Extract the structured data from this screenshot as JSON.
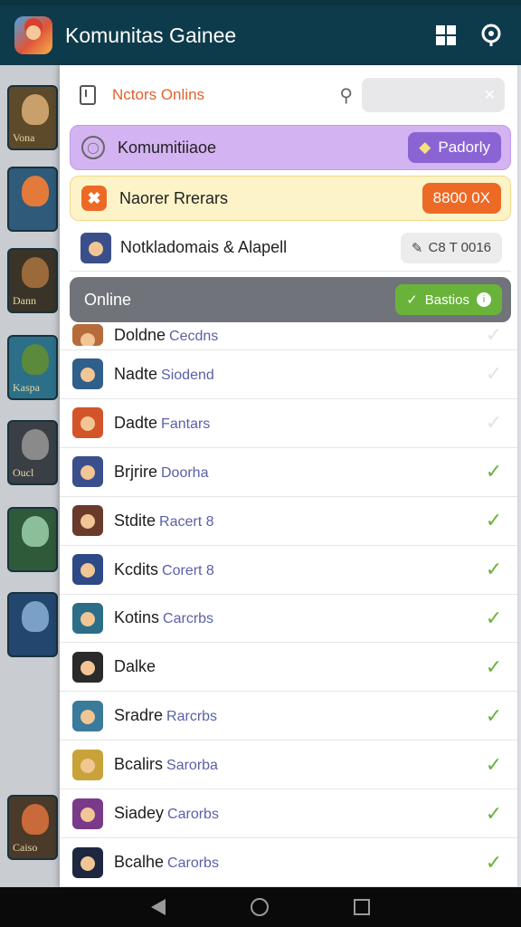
{
  "app": {
    "title": "Komunitas Gainee"
  },
  "appbar": {
    "grid_icon": "grid-icon",
    "help_icon": "help-icon"
  },
  "search": {
    "label": "Nctors Onlins",
    "placeholder": ""
  },
  "highlights": [
    {
      "label": "Komumitiiaoe",
      "badge": "Padorly",
      "style": "purple"
    },
    {
      "label": "Naorer Rrerars",
      "badge": "8800 0X",
      "style": "yellow"
    },
    {
      "label": "Notkladomais & Alapell",
      "badge": "C8 T 0016",
      "style": "plain"
    },
    {
      "label": "Online",
      "badge": "Bastios",
      "style": "dark"
    }
  ],
  "rows": [
    {
      "name": "Doldne",
      "sub": "Cecdns",
      "checked": false,
      "color": "#b56b3a"
    },
    {
      "name": "Nadte",
      "sub": "Siodend",
      "checked": false,
      "color": "#2f5f8a"
    },
    {
      "name": "Dadte",
      "sub": "Fantars",
      "checked": false,
      "color": "#d4542a"
    },
    {
      "name": "Brjrire",
      "sub": "Doorha",
      "checked": true,
      "color": "#3b4f8c"
    },
    {
      "name": "Stdite",
      "sub": "Racert 8",
      "checked": true,
      "color": "#6a3a2a"
    },
    {
      "name": "Kcdits",
      "sub": "Corert 8",
      "checked": true,
      "color": "#2d4a86"
    },
    {
      "name": "Kotins",
      "sub": "Carcrbs",
      "checked": true,
      "color": "#2c6e88"
    },
    {
      "name": "Dalke",
      "sub": "",
      "checked": true,
      "color": "#2a2a2a"
    },
    {
      "name": "Sradre",
      "sub": "Rarcrbs",
      "checked": true,
      "color": "#3a7a9a"
    },
    {
      "name": "Bcalirs",
      "sub": "Sarorba",
      "checked": true,
      "color": "#c9a23a"
    },
    {
      "name": "Siadey",
      "sub": "Carorbs",
      "checked": true,
      "color": "#7a3a8a"
    },
    {
      "name": "Bcalhe",
      "sub": "Carorbs",
      "checked": true,
      "color": "#1e2740"
    }
  ],
  "background_cards": [
    "Vona",
    "",
    "Dann",
    "Kaspa",
    "Oucl",
    "",
    "",
    "Caiso"
  ]
}
